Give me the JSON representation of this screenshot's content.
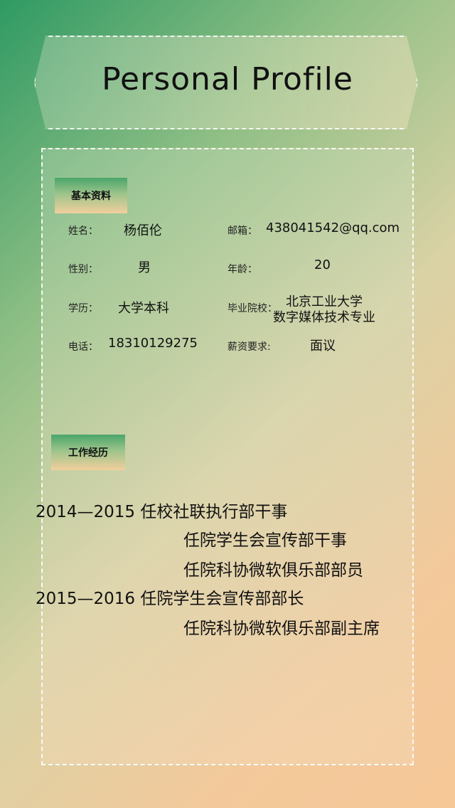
{
  "header": {
    "title": "Personal Profile"
  },
  "basic_info": {
    "section_label": "基本资料",
    "name_label": "姓名：",
    "name_value": "杨佰伦",
    "email_label": "邮箱：",
    "email_value": "438041542@qq.com",
    "gender_label": "性别：",
    "gender_value": "男",
    "age_label": "年龄：",
    "age_value": "20",
    "education_label": "学历：",
    "education_value": "大学本科",
    "school_label": "毕业院校：",
    "school_value_line1": "北京工业大学",
    "school_value_line2": "数字媒体技术专业",
    "phone_label": "电话：",
    "phone_value": "18310129275",
    "salary_label": "薪资要求:",
    "salary_value": "面议"
  },
  "work_experience": {
    "section_label": "工作经历",
    "lines": [
      "2014—2015 任校社联执行部干事",
      "任院学生会宣传部干事",
      "任院科协微软俱乐部部员",
      "2015—2016 任院学生会宣传部部长",
      "任院科协微软俱乐部副主席"
    ]
  }
}
